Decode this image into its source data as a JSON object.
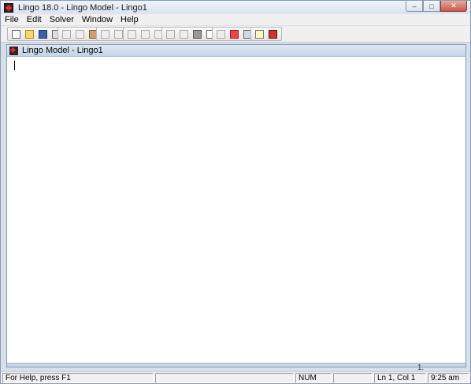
{
  "window": {
    "title": "Lingo 18.0 - Lingo Model - Lingo1"
  },
  "caption_buttons": [
    {
      "icon": "minimize-icon",
      "glyph": "–"
    },
    {
      "icon": "maximize-icon",
      "glyph": "□"
    },
    {
      "icon": "close-icon",
      "glyph": "✕"
    }
  ],
  "menu": [
    "File",
    "Edit",
    "Solver",
    "Window",
    "Help"
  ],
  "toolbar_icons": [
    "new-icon",
    "open-icon",
    "save-icon",
    "print-icon",
    "cut-icon",
    "copy-icon",
    "paste-icon",
    "undo-icon",
    "redo-icon",
    "find-icon",
    "goto-line-icon",
    "match-parenthesis-icon",
    "solve-icon",
    "solution-icon",
    "options-icon",
    "close-all-icon",
    "send-to-back-icon",
    "tile-icon",
    "cascade-icon",
    "help-topics-icon",
    "context-help-icon"
  ],
  "child_window": {
    "title": "Lingo Model - Lingo1"
  },
  "page_indicator": "1.",
  "status": {
    "help": "For Help, press F1",
    "num": "NUM",
    "position": "Ln 1, Col 1",
    "time": "9:25 am"
  }
}
